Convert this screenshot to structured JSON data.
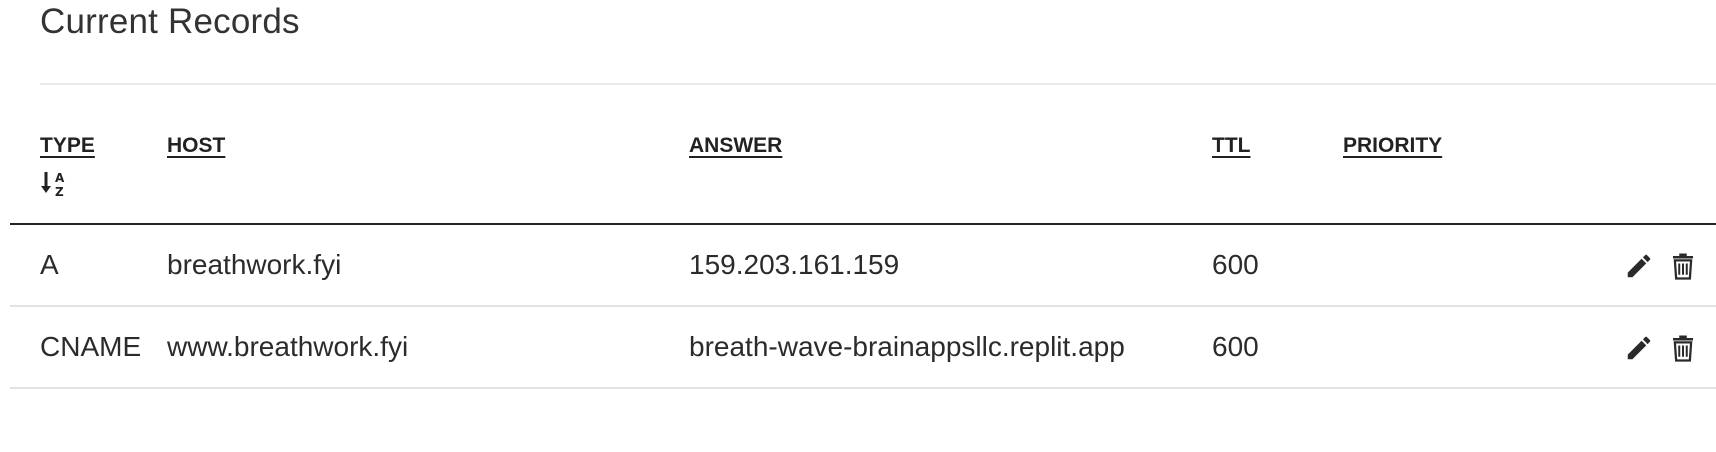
{
  "page": {
    "title": "Current Records"
  },
  "table": {
    "columns": [
      {
        "key": "type",
        "label": "TYPE",
        "sortable": true,
        "sort_icon": "sort-alpha-down-icon"
      },
      {
        "key": "host",
        "label": "HOST"
      },
      {
        "key": "answer",
        "label": "ANSWER"
      },
      {
        "key": "ttl",
        "label": "TTL"
      },
      {
        "key": "priority",
        "label": "PRIORITY"
      }
    ],
    "rows": [
      {
        "type": "A",
        "host": "breathwork.fyi",
        "answer": "159.203.161.159",
        "ttl": "600",
        "priority": "",
        "actions": [
          "pencil-icon",
          "trash-icon"
        ]
      },
      {
        "type": "CNAME",
        "host": "www.breathwork.fyi",
        "answer": "breath-wave-brainappsllc.replit.app",
        "ttl": "600",
        "priority": "",
        "actions": [
          "pencil-icon",
          "trash-icon"
        ]
      }
    ]
  },
  "colors": {
    "text": "#222222",
    "header_rule": "#222222",
    "row_rule": "#e3e3e3",
    "title_rule": "#ebebeb",
    "icon": "#2a2a2a"
  }
}
